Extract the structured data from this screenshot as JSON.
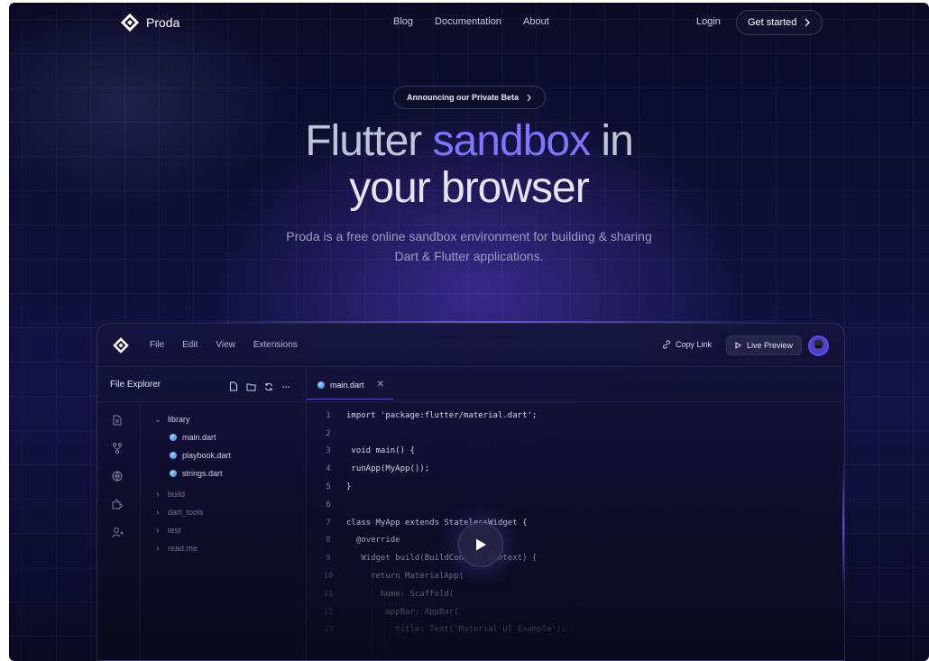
{
  "nav": {
    "brand": "Proda",
    "links": [
      "Blog",
      "Documentation",
      "About"
    ],
    "login": "Login",
    "cta": "Get started"
  },
  "hero": {
    "announcement": "Announcing our Private Beta",
    "headline_part1": "Flutter ",
    "headline_accent": "sandbox",
    "headline_part2": " in",
    "headline_line2": "your browser",
    "subtitle": "Proda is a free online sandbox environment for building & sharing Dart & Flutter applications."
  },
  "editor": {
    "menu": [
      "File",
      "Edit",
      "View",
      "Extensions"
    ],
    "copy_link": "Copy Link",
    "live_preview": "Live Preview",
    "explorer_title": "File Explorer",
    "tab_name": "main.dart",
    "tree": {
      "folder": "library",
      "files": [
        "main.dart",
        "playbook.dart",
        "strings.dart"
      ],
      "collapsed": [
        "build",
        "dart_tools",
        "test",
        "read.me"
      ]
    },
    "code_lines": [
      {
        "n": "1",
        "t": "import 'package:flutter/material.dart';"
      },
      {
        "n": "2",
        "t": ""
      },
      {
        "n": "3",
        "t": " void main() {"
      },
      {
        "n": "4",
        "t": " runApp(MyApp());"
      },
      {
        "n": "5",
        "t": "}"
      },
      {
        "n": "6",
        "t": ""
      },
      {
        "n": "7",
        "t": "class MyApp extends StatelessWidget {"
      },
      {
        "n": "8",
        "t": "  @override"
      },
      {
        "n": "9",
        "t": "   Widget build(BuildContext context) {"
      },
      {
        "n": "10",
        "t": "     return MaterialApp("
      },
      {
        "n": "11",
        "t": "       home: Scaffold("
      },
      {
        "n": "12",
        "t": "        appBar: AppBar("
      },
      {
        "n": "13",
        "t": "          title: Text('Material UI Example'),"
      }
    ]
  },
  "colors": {
    "accent": "#7d74ff",
    "background": "#0b0b26"
  }
}
